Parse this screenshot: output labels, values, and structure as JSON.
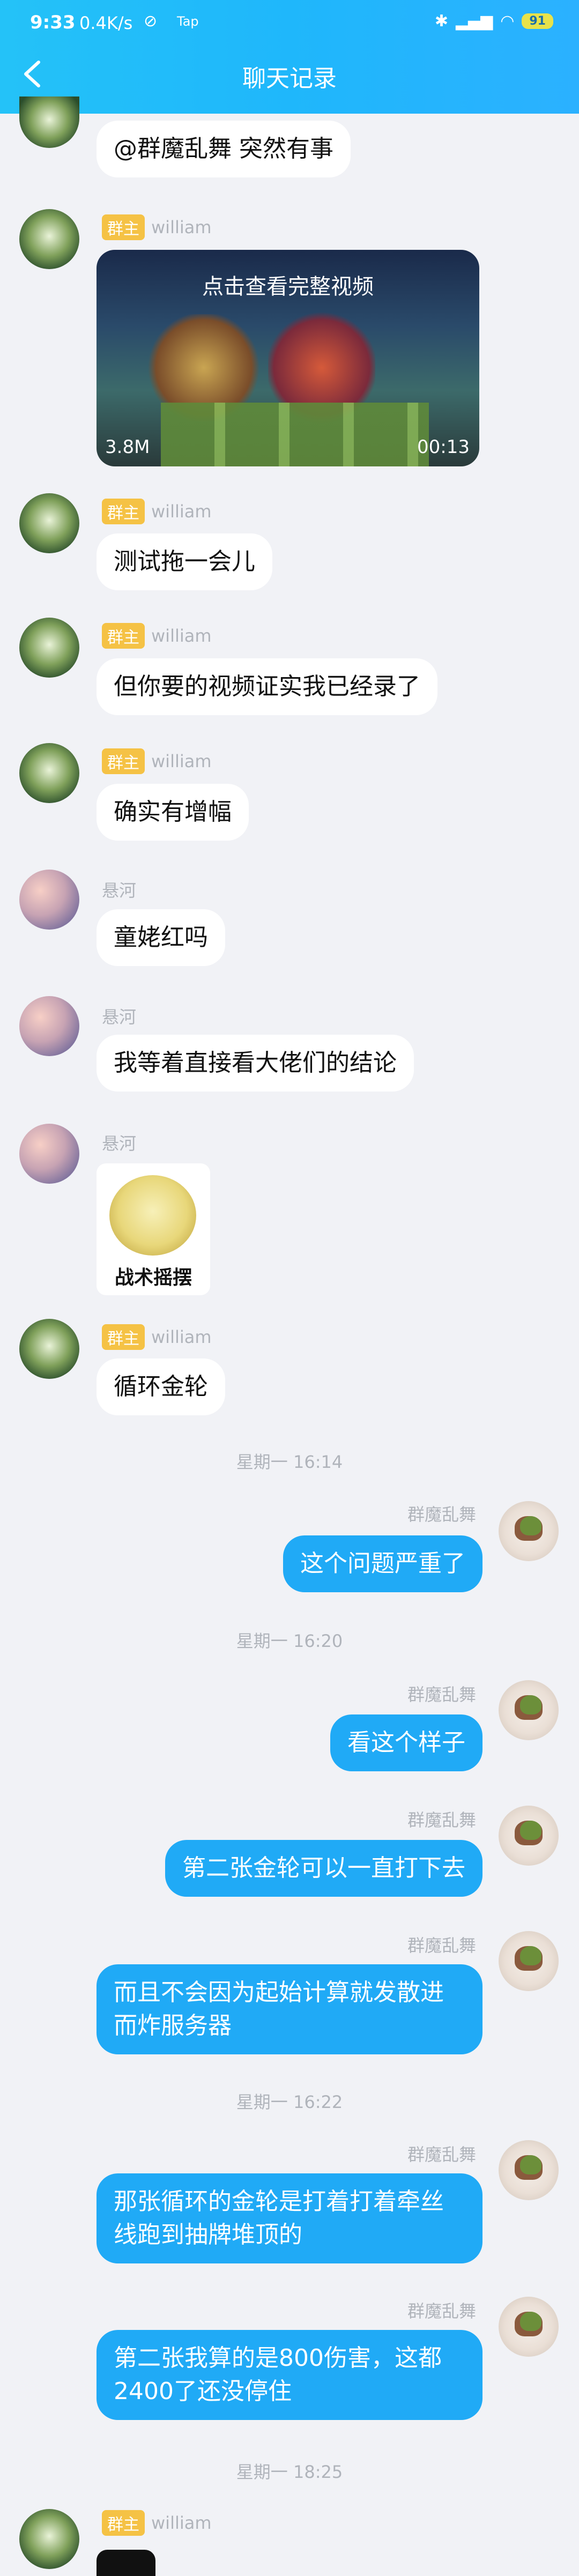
{
  "status_bar": {
    "time": "9:33",
    "speed": "0.4K/s",
    "extra": "Tap",
    "battery": "91"
  },
  "header": {
    "title": "聊天记录"
  },
  "messages": {
    "m0": {
      "text": "@群魔乱舞 突然有事"
    },
    "m1": {
      "badge": "群主",
      "name": "william",
      "video": {
        "overlay": "点击查看完整视频",
        "size": "3.8M",
        "duration": "00:13"
      }
    },
    "m2": {
      "badge": "群主",
      "name": "william",
      "text": "测试拖一会儿"
    },
    "m3": {
      "badge": "群主",
      "name": "william",
      "text": "但你要的视频证实我已经录了"
    },
    "m4": {
      "badge": "群主",
      "name": "william",
      "text": "确实有增幅"
    },
    "m5": {
      "name": "悬河",
      "text": "童姥红吗"
    },
    "m6": {
      "name": "悬河",
      "text": "我等着直接看大佬们的结论"
    },
    "m7": {
      "name": "悬河",
      "sticker_caption": "战术摇摆"
    },
    "m8": {
      "badge": "群主",
      "name": "william",
      "text": "循环金轮"
    },
    "t1": "星期一 16:14",
    "m9": {
      "name": "群魔乱舞",
      "text": "这个问题严重了"
    },
    "t2": "星期一 16:20",
    "m10": {
      "name": "群魔乱舞",
      "text": "看这个样子"
    },
    "m11": {
      "name": "群魔乱舞",
      "text": "第二张金轮可以一直打下去"
    },
    "m12": {
      "name": "群魔乱舞",
      "line1": "而且不会因为起始计算就发散进",
      "line2": "而炸服务器"
    },
    "t3": "星期一 16:22",
    "m13": {
      "name": "群魔乱舞",
      "line1": "那张循环的金轮是打着打着牵丝",
      "line2": "线跑到抽牌堆顶的"
    },
    "m14": {
      "name": "群魔乱舞",
      "line1": "第二张我算的是800伤害，这都",
      "line2": "2400了还没停住"
    },
    "t4": "星期一 18:25",
    "m15": {
      "badge": "群主",
      "name": "william"
    }
  }
}
